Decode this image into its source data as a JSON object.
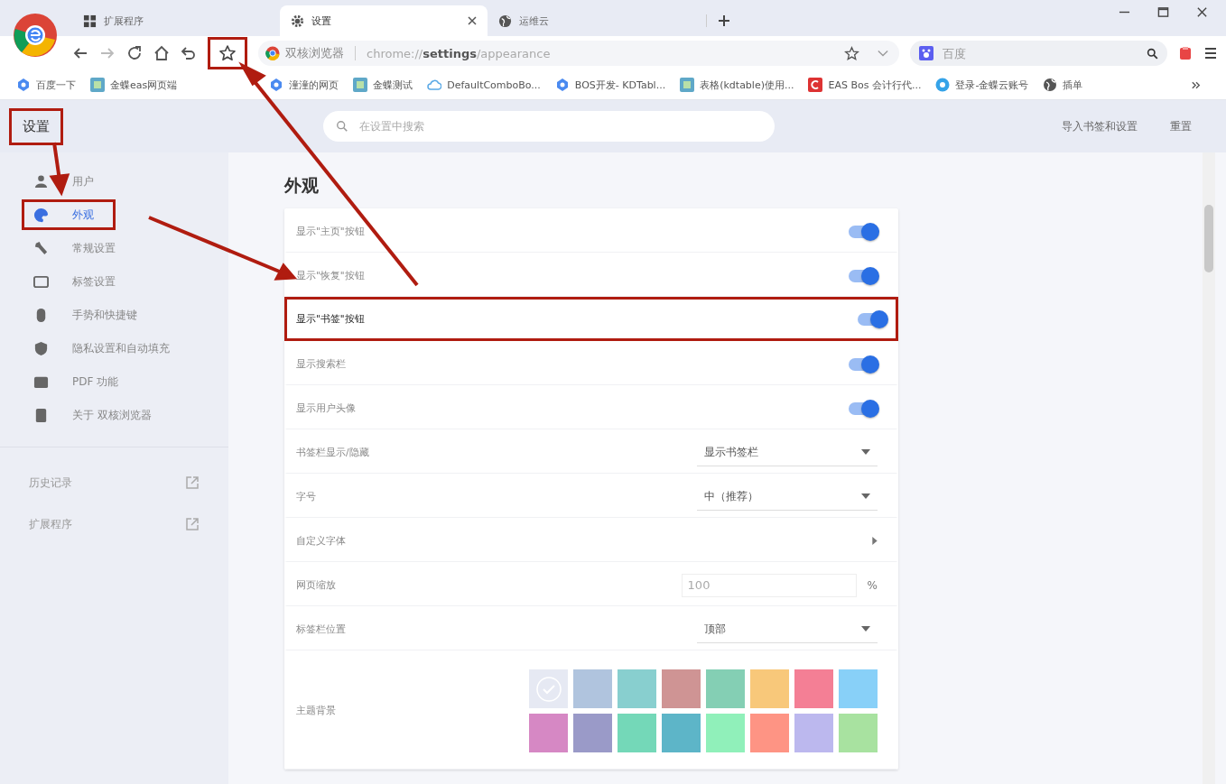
{
  "tabs": [
    {
      "label": "扩展程序",
      "selected": false
    },
    {
      "label": "设置",
      "selected": true
    },
    {
      "label": "运维云",
      "selected": false
    }
  ],
  "address_bar": {
    "site": "双核浏览器",
    "url": "chrome://**settings**/appearance"
  },
  "bookmark_star": {
    "highlighted": true
  },
  "search_box": {
    "placeholder": "百度"
  },
  "bookmarks": [
    {
      "label": "百度一下"
    },
    {
      "label": "金蝶eas网页端"
    },
    {
      "label": "潼潼的网页"
    },
    {
      "label": "金蝶测试"
    },
    {
      "label": "DefaultComboBo..."
    },
    {
      "label": "BOS开发- KDTabl..."
    },
    {
      "label": "表格(kdtable)使用..."
    },
    {
      "label": "EAS Bos 会计行代..."
    },
    {
      "label": "登录-金蝶云账号"
    },
    {
      "label": "插单"
    }
  ],
  "settings_header": {
    "title": "设置",
    "highlighted": true,
    "search_placeholder": "在设置中搜索",
    "actions": [
      "导入书签和设置",
      "重置"
    ]
  },
  "sidebar": {
    "items": [
      {
        "label": "用户",
        "selected": false,
        "highlighted": false
      },
      {
        "label": "外观",
        "selected": true,
        "highlighted": true
      },
      {
        "label": "常规设置",
        "selected": false,
        "highlighted": false
      },
      {
        "label": "标签设置",
        "selected": false,
        "highlighted": false
      },
      {
        "label": "手势和快捷键",
        "selected": false,
        "highlighted": false
      },
      {
        "label": "隐私设置和自动填充",
        "selected": false,
        "highlighted": false
      },
      {
        "label": "PDF 功能",
        "selected": false,
        "highlighted": false
      },
      {
        "label": "关于 双核浏览器",
        "selected": false,
        "highlighted": false
      }
    ],
    "links": [
      {
        "label": "历史记录"
      },
      {
        "label": "扩展程序"
      }
    ]
  },
  "section": {
    "title": "外观",
    "rows": [
      {
        "kind": "toggle",
        "label": "显示\"主页\"按钮",
        "on": true,
        "highlighted": false
      },
      {
        "kind": "toggle",
        "label": "显示\"恢复\"按钮",
        "on": true,
        "highlighted": false
      },
      {
        "kind": "toggle",
        "label": "显示\"书签\"按钮",
        "on": true,
        "highlighted": true
      },
      {
        "kind": "toggle",
        "label": "显示搜索栏",
        "on": true,
        "highlighted": false
      },
      {
        "kind": "toggle",
        "label": "显示用户头像",
        "on": true,
        "highlighted": false
      },
      {
        "kind": "select",
        "label": "书签栏显示/隐藏",
        "value": "显示书签栏",
        "highlighted": false
      },
      {
        "kind": "select",
        "label": "字号",
        "value": "中（推荐）",
        "highlighted": false
      },
      {
        "kind": "link",
        "label": "自定义字体",
        "highlighted": false
      },
      {
        "kind": "number",
        "label": "网页缩放",
        "placeholder": "100",
        "unit": "%",
        "highlighted": false
      },
      {
        "kind": "select",
        "label": "标签栏位置",
        "value": "顶部",
        "highlighted": false
      },
      {
        "kind": "themes",
        "label": "主题背景",
        "highlighted": false,
        "swatches": [
          {
            "color": "#e6e9f3",
            "selected": true
          },
          {
            "color": "#b0c4de",
            "selected": false
          },
          {
            "color": "#88cfcf",
            "selected": false
          },
          {
            "color": "#cf9494",
            "selected": false
          },
          {
            "color": "#84cfb4",
            "selected": false
          },
          {
            "color": "#f8c87a",
            "selected": false
          },
          {
            "color": "#f47f95",
            "selected": false
          },
          {
            "color": "#88d0f8",
            "selected": false
          },
          {
            "color": "#d688c4",
            "selected": false
          },
          {
            "color": "#9a9ac8",
            "selected": false
          },
          {
            "color": "#74d8b8",
            "selected": false
          },
          {
            "color": "#5db5c8",
            "selected": false
          },
          {
            "color": "#90f0ba",
            "selected": false
          },
          {
            "color": "#fe9484",
            "selected": false
          },
          {
            "color": "#bcb8ee",
            "selected": false
          },
          {
            "color": "#a8e2a0",
            "selected": false
          }
        ]
      }
    ]
  }
}
